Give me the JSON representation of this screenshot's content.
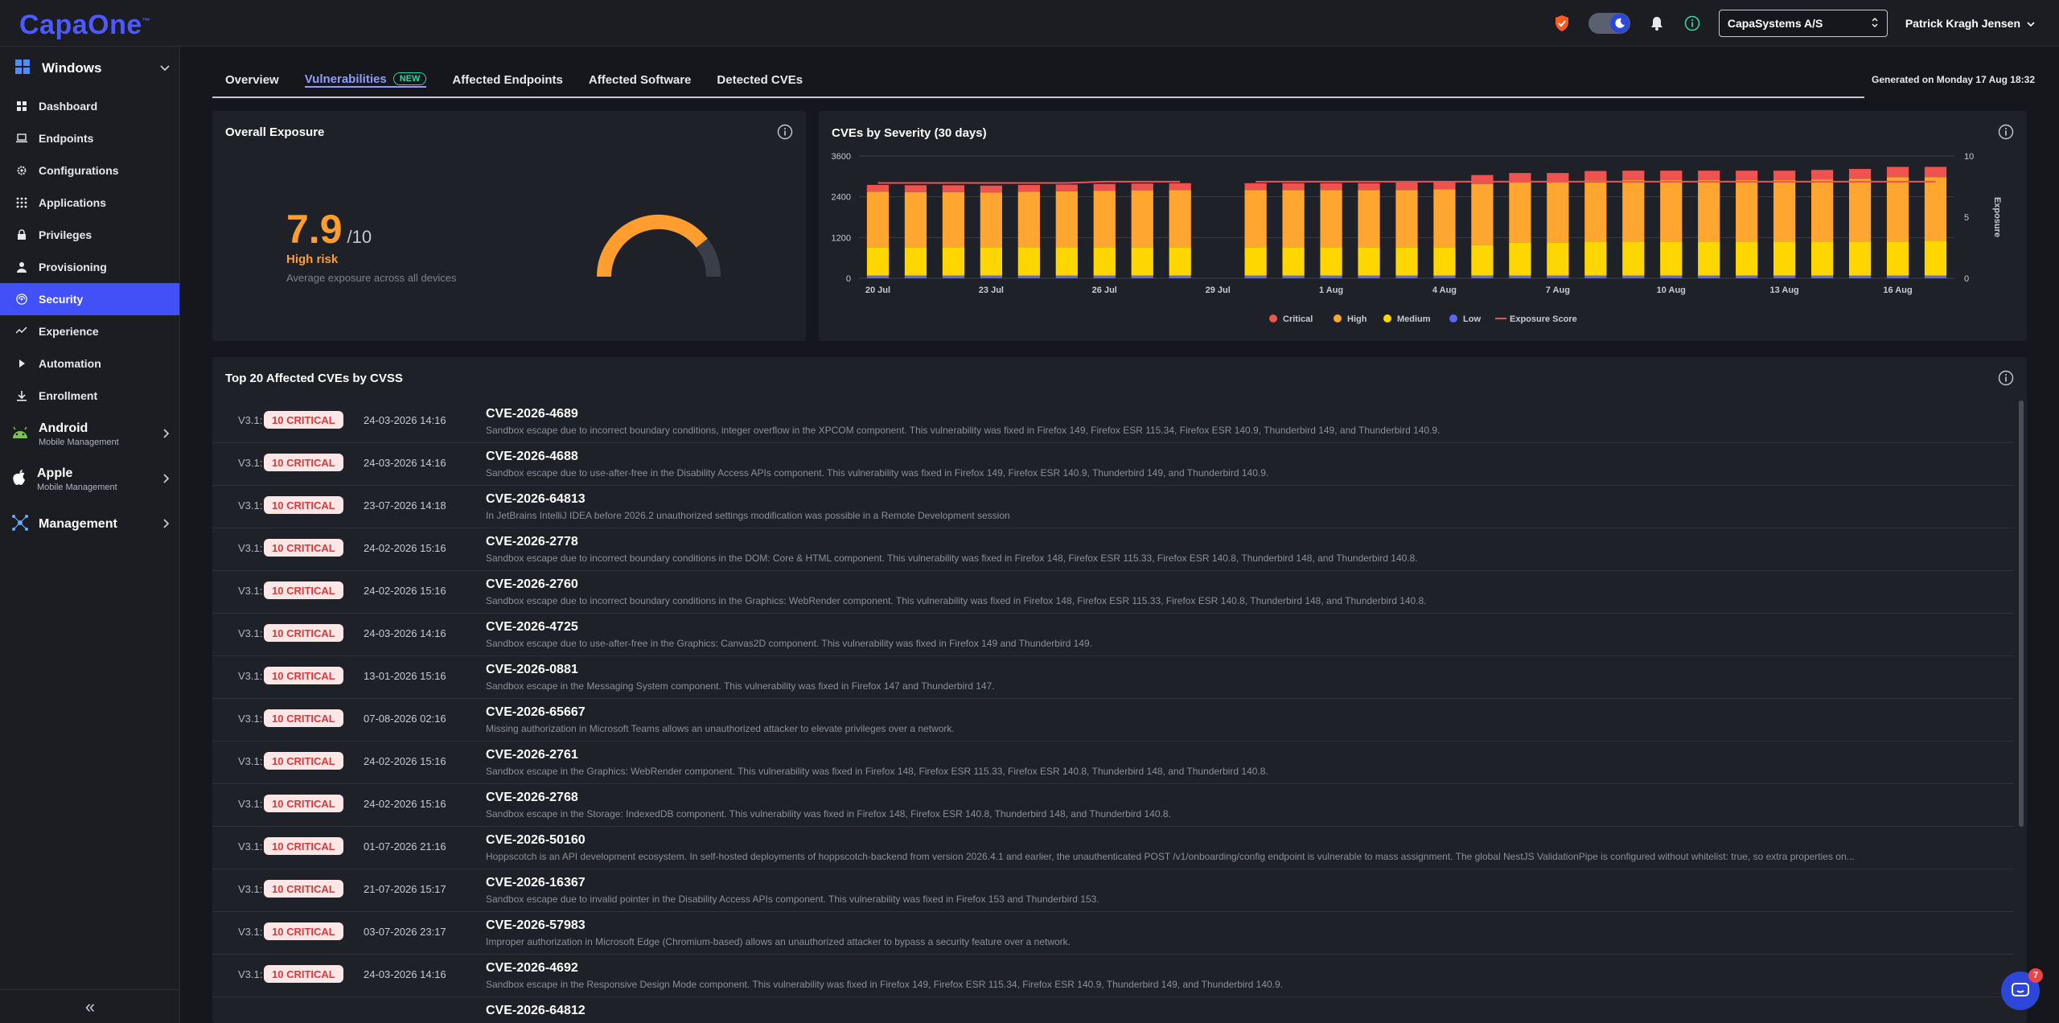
{
  "app": {
    "logo": "CapaOne",
    "logo_mark": "™"
  },
  "topbar": {
    "company": "CapaSystems A/S",
    "user": "Patrick Kragh Jensen",
    "icons": [
      "shield-icon",
      "theme-toggle-icon",
      "bell-icon",
      "info-icon"
    ]
  },
  "sidebar": {
    "platform": "Windows",
    "items": [
      {
        "label": "Dashboard",
        "icon": "grid-icon"
      },
      {
        "label": "Endpoints",
        "icon": "laptop-icon"
      },
      {
        "label": "Configurations",
        "icon": "gear-icon"
      },
      {
        "label": "Applications",
        "icon": "apps-icon"
      },
      {
        "label": "Privileges",
        "icon": "lock-icon"
      },
      {
        "label": "Provisioning",
        "icon": "user-icon"
      },
      {
        "label": "Security",
        "icon": "security-icon"
      },
      {
        "label": "Experience",
        "icon": "pulse-icon"
      },
      {
        "label": "Automation",
        "icon": "play-icon"
      },
      {
        "label": "Enrollment",
        "icon": "download-icon"
      }
    ],
    "active_index": 6,
    "platforms": [
      {
        "title": "Android",
        "sub": "Mobile Management"
      },
      {
        "title": "Apple",
        "sub": "Mobile Management"
      },
      {
        "title": "Management",
        "sub": ""
      }
    ],
    "collapse": "«"
  },
  "tabs": [
    {
      "label": "Overview"
    },
    {
      "label": "Vulnerabilities",
      "badge": "NEW"
    },
    {
      "label": "Affected Endpoints"
    },
    {
      "label": "Affected Software"
    },
    {
      "label": "Detected CVEs"
    }
  ],
  "generated": "Generated on Monday 17 Aug 18:32",
  "exposure": {
    "title": "Overall Exposure",
    "score": "7.9",
    "max": "/10",
    "value": 7.9,
    "risk": "High risk",
    "sub": "Average exposure across all devices",
    "color": "#ff9d2e"
  },
  "chart_data": {
    "type": "bar",
    "title": "CVEs by Severity (30 days)",
    "ylabel_right": "Exposure",
    "ylim": [
      0,
      3600
    ],
    "ylim_right": [
      0,
      10
    ],
    "yticks": [
      "0",
      "1200",
      "2400",
      "3600"
    ],
    "yticks_right": [
      "0",
      "5",
      "10"
    ],
    "xtick_labels": [
      "20 Jul",
      "23 Jul",
      "26 Jul",
      "29 Jul",
      "1 Aug",
      "4 Aug",
      "7 Aug",
      "10 Aug",
      "13 Aug",
      "16 Aug"
    ],
    "legend": [
      "Critical",
      "High",
      "Medium",
      "Low",
      "Exposure Score"
    ],
    "colors": {
      "Critical": "#ef5350",
      "High": "#ffa630",
      "Medium": "#ffd600",
      "Low": "#5a67f5",
      "Exposure Score": "#ef5350"
    },
    "categories": [
      "20 Jul",
      "21 Jul",
      "22 Jul",
      "23 Jul",
      "24 Jul",
      "25 Jul",
      "26 Jul",
      "27 Jul",
      "28 Jul",
      "29 Jul",
      "30 Jul",
      "31 Jul",
      "1 Aug",
      "2 Aug",
      "3 Aug",
      "4 Aug",
      "5 Aug",
      "6 Aug",
      "7 Aug",
      "8 Aug",
      "9 Aug",
      "10 Aug",
      "11 Aug",
      "12 Aug",
      "13 Aug",
      "14 Aug",
      "15 Aug",
      "16 Aug",
      "17 Aug"
    ],
    "series": [
      {
        "name": "Low",
        "values": [
          80,
          80,
          80,
          80,
          80,
          80,
          80,
          80,
          80,
          null,
          80,
          80,
          80,
          80,
          80,
          80,
          80,
          80,
          80,
          80,
          80,
          80,
          80,
          80,
          80,
          80,
          80,
          80,
          80
        ]
      },
      {
        "name": "Medium",
        "values": [
          820,
          820,
          820,
          820,
          820,
          820,
          820,
          820,
          820,
          null,
          820,
          820,
          820,
          820,
          820,
          820,
          900,
          980,
          980,
          1000,
          1000,
          1000,
          1000,
          1000,
          1000,
          1000,
          1000,
          1000,
          1020
        ]
      },
      {
        "name": "High",
        "values": [
          1650,
          1640,
          1640,
          1630,
          1650,
          1660,
          1680,
          1690,
          1700,
          null,
          1700,
          1700,
          1700,
          1700,
          1700,
          1720,
          1800,
          1780,
          1780,
          1800,
          1810,
          1810,
          1810,
          1810,
          1810,
          1830,
          1850,
          1900,
          1880
        ]
      },
      {
        "name": "Critical",
        "values": [
          200,
          200,
          200,
          200,
          200,
          200,
          200,
          200,
          200,
          null,
          200,
          200,
          200,
          200,
          220,
          230,
          260,
          260,
          260,
          280,
          280,
          280,
          280,
          280,
          280,
          280,
          290,
          300,
          300
        ]
      },
      {
        "name": "Exposure Score",
        "values": [
          7.8,
          7.8,
          7.8,
          7.8,
          7.8,
          7.8,
          7.9,
          7.9,
          7.9,
          null,
          7.9,
          7.9,
          7.9,
          7.9,
          7.9,
          7.9,
          7.9,
          7.9,
          7.9,
          7.9,
          7.9,
          7.9,
          7.9,
          7.9,
          7.9,
          7.9,
          7.9,
          7.9,
          7.9
        ]
      }
    ]
  },
  "cve_table": {
    "title": "Top 20 Affected CVEs by CVSS",
    "rows": [
      {
        "ver": "V3.1:",
        "sev": "10 CRITICAL",
        "date": "24-03-2026 14:16",
        "id": "CVE-2026-4689",
        "desc": "Sandbox escape due to incorrect boundary conditions, integer overflow in the XPCOM component. This vulnerability was fixed in Firefox 149, Firefox ESR 115.34, Firefox ESR 140.9, Thunderbird 149, and Thunderbird 140.9."
      },
      {
        "ver": "V3.1:",
        "sev": "10 CRITICAL",
        "date": "24-03-2026 14:16",
        "id": "CVE-2026-4688",
        "desc": "Sandbox escape due to use-after-free in the Disability Access APIs component. This vulnerability was fixed in Firefox 149, Firefox ESR 140.9, Thunderbird 149, and Thunderbird 140.9."
      },
      {
        "ver": "V3.1:",
        "sev": "10 CRITICAL",
        "date": "23-07-2026 14:18",
        "id": "CVE-2026-64813",
        "desc": "In JetBrains IntelliJ IDEA before 2026.2 unauthorized settings modification was possible in a Remote Development session"
      },
      {
        "ver": "V3.1:",
        "sev": "10 CRITICAL",
        "date": "24-02-2026 15:16",
        "id": "CVE-2026-2778",
        "desc": "Sandbox escape due to incorrect boundary conditions in the DOM: Core & HTML component. This vulnerability was fixed in Firefox 148, Firefox ESR 115.33, Firefox ESR 140.8, Thunderbird 148, and Thunderbird 140.8."
      },
      {
        "ver": "V3.1:",
        "sev": "10 CRITICAL",
        "date": "24-02-2026 15:16",
        "id": "CVE-2026-2760",
        "desc": "Sandbox escape due to incorrect boundary conditions in the Graphics: WebRender component. This vulnerability was fixed in Firefox 148, Firefox ESR 115.33, Firefox ESR 140.8, Thunderbird 148, and Thunderbird 140.8."
      },
      {
        "ver": "V3.1:",
        "sev": "10 CRITICAL",
        "date": "24-03-2026 14:16",
        "id": "CVE-2026-4725",
        "desc": "Sandbox escape due to use-after-free in the Graphics: Canvas2D component. This vulnerability was fixed in Firefox 149 and Thunderbird 149."
      },
      {
        "ver": "V3.1:",
        "sev": "10 CRITICAL",
        "date": "13-01-2026 15:16",
        "id": "CVE-2026-0881",
        "desc": "Sandbox escape in the Messaging System component. This vulnerability was fixed in Firefox 147 and Thunderbird 147."
      },
      {
        "ver": "V3.1:",
        "sev": "10 CRITICAL",
        "date": "07-08-2026 02:16",
        "id": "CVE-2026-65667",
        "desc": "Missing authorization in Microsoft Teams allows an unauthorized attacker to elevate privileges over a network."
      },
      {
        "ver": "V3.1:",
        "sev": "10 CRITICAL",
        "date": "24-02-2026 15:16",
        "id": "CVE-2026-2761",
        "desc": "Sandbox escape in the Graphics: WebRender component. This vulnerability was fixed in Firefox 148, Firefox ESR 115.33, Firefox ESR 140.8, Thunderbird 148, and Thunderbird 140.8."
      },
      {
        "ver": "V3.1:",
        "sev": "10 CRITICAL",
        "date": "24-02-2026 15:16",
        "id": "CVE-2026-2768",
        "desc": "Sandbox escape in the Storage: IndexedDB component. This vulnerability was fixed in Firefox 148, Firefox ESR 140.8, Thunderbird 148, and Thunderbird 140.8."
      },
      {
        "ver": "V3.1:",
        "sev": "10 CRITICAL",
        "date": "01-07-2026 21:16",
        "id": "CVE-2026-50160",
        "desc": "Hoppscotch is an API development ecosystem. In self-hosted deployments of hoppscotch-backend from version 2026.4.1 and earlier, the unauthenticated POST /v1/onboarding/config endpoint is vulnerable to mass assignment. The global NestJS ValidationPipe is configured without whitelist: true, so extra properties on..."
      },
      {
        "ver": "V3.1:",
        "sev": "10 CRITICAL",
        "date": "21-07-2026 15:17",
        "id": "CVE-2026-16367",
        "desc": "Sandbox escape due to invalid pointer in the Disability Access APIs component. This vulnerability was fixed in Firefox 153 and Thunderbird 153."
      },
      {
        "ver": "V3.1:",
        "sev": "10 CRITICAL",
        "date": "03-07-2026 23:17",
        "id": "CVE-2026-57983",
        "desc": "Improper authorization in Microsoft Edge (Chromium-based) allows an unauthorized attacker to bypass a security feature over a network."
      },
      {
        "ver": "V3.1:",
        "sev": "10 CRITICAL",
        "date": "24-03-2026 14:16",
        "id": "CVE-2026-4692",
        "desc": "Sandbox escape in the Responsive Design Mode component. This vulnerability was fixed in Firefox 149, Firefox ESR 115.34, Firefox ESR 140.9, Thunderbird 149, and Thunderbird 140.9."
      },
      {
        "ver": "",
        "sev": "",
        "date": "",
        "id": "CVE-2026-64812",
        "desc": ""
      }
    ]
  },
  "chat": {
    "badge": "7"
  }
}
